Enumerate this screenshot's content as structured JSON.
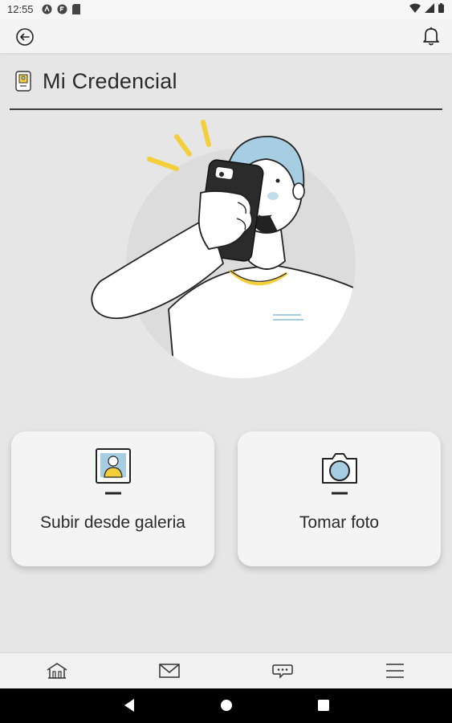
{
  "status_bar": {
    "time": "12:55"
  },
  "header": {
    "title": "Mi Credencial"
  },
  "actions": {
    "gallery_label": "Subir desde galeria",
    "camera_label": "Tomar foto"
  },
  "icons": {
    "back": "back-arrow-icon",
    "notifications": "bell-icon",
    "title": "credential-card-icon",
    "gallery": "photo-portrait-icon",
    "camera": "camera-icon",
    "nav_home": "home-icon",
    "nav_mail": "mail-icon",
    "nav_chat": "chat-icon",
    "nav_menu": "menu-icon"
  },
  "colors": {
    "accent_blue": "#a7cde3",
    "accent_yellow": "#f4cf3c",
    "background": "#e6e6e6",
    "card": "#f4f4f4"
  }
}
